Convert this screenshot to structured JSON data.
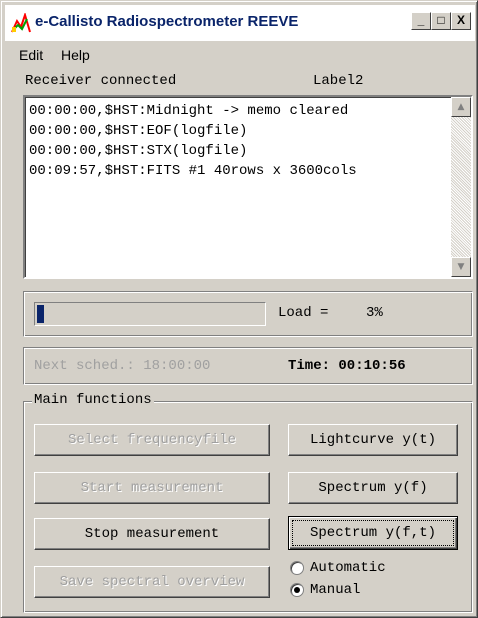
{
  "window": {
    "title": "e-Callisto Radiospectrometer  REEVE",
    "controls": {
      "minimize": "_",
      "maximize": "□",
      "close": "X"
    }
  },
  "menu": [
    "Edit",
    "Help"
  ],
  "status": {
    "receiver": "Receiver connected",
    "label2": "Label2"
  },
  "log": {
    "lines": [
      "00:00:00,$HST:Midnight -> memo cleared",
      "00:00:00,$HST:EOF(logfile)",
      "00:00:00,$HST:STX(logfile)",
      "00:09:57,$HST:FITS #1 40rows x 3600cols"
    ]
  },
  "load": {
    "label": "Load =",
    "value": "3%",
    "progress_fraction": 0.03
  },
  "schedule": {
    "next": "Next sched.: 18:00:00",
    "time": "Time: 00:10:56"
  },
  "main": {
    "title": "Main functions",
    "select_frequencyfile": "Select frequencyfile",
    "start_measurement": "Start measurement",
    "stop_measurement": "Stop measurement",
    "save_spectral_overview": "Save spectral overview",
    "lightcurve": "Lightcurve y(t)",
    "spectrum_f": "Spectrum y(f)",
    "spectrum_ft": "Spectrum y(f,t)",
    "automatic": "Automatic",
    "manual": "Manual",
    "selected_mode": "Manual"
  },
  "colors": {
    "face": "#d4d0c8",
    "title_text": "#0a246a",
    "progress": "#0a246a",
    "disabled_text": "#a0a0a0"
  }
}
